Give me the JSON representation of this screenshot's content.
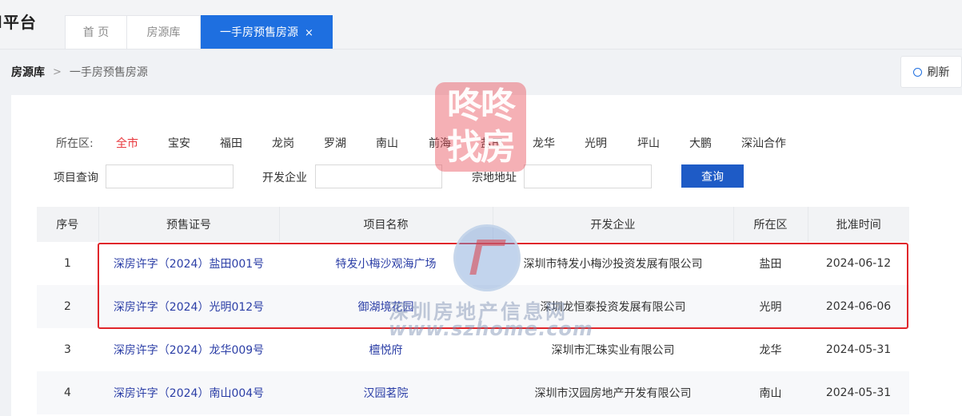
{
  "header": {
    "brand": "l平台",
    "tabs": [
      {
        "label": "首 页"
      },
      {
        "label": "房源库"
      },
      {
        "label": "一手房预售房源",
        "close": "×"
      }
    ]
  },
  "breadcrumb": {
    "root": "房源库",
    "sep": ">",
    "current": "一手房预售房源"
  },
  "refresh_label": "刷新",
  "filter": {
    "district_label": "所在区:",
    "districts": [
      "全市",
      "宝安",
      "福田",
      "龙岗",
      "罗湖",
      "南山",
      "前海",
      "盐田",
      "龙华",
      "光明",
      "坪山",
      "大鹏",
      "深汕合作"
    ],
    "active_district": "全市",
    "project_label": "项目查询",
    "developer_label": "开发企业",
    "address_label": "宗地地址",
    "project_value": "",
    "developer_value": "",
    "address_value": "",
    "search_button": "查询"
  },
  "table": {
    "headers": [
      "序号",
      "预售证号",
      "项目名称",
      "开发企业",
      "所在区",
      "批准时间"
    ],
    "rows": [
      {
        "no": "1",
        "cert": "深房许字（2024）盐田001号",
        "name": "特发小梅沙观海广场",
        "dev": "深圳市特发小梅沙投资发展有限公司",
        "dist": "盐田",
        "date": "2024-06-12"
      },
      {
        "no": "2",
        "cert": "深房许字（2024）光明012号",
        "name": "御湖境花园",
        "dev": "深圳龙恒泰投资发展有限公司",
        "dist": "光明",
        "date": "2024-06-06"
      },
      {
        "no": "3",
        "cert": "深房许字（2024）龙华009号",
        "name": "檀悦府",
        "dev": "深圳市汇珠实业有限公司",
        "dist": "龙华",
        "date": "2024-05-31"
      },
      {
        "no": "4",
        "cert": "深房许字（2024）南山004号",
        "name": "汉园茗院",
        "dev": "深圳市汉园房地产开发有限公司",
        "dist": "南山",
        "date": "2024-05-31"
      }
    ]
  },
  "watermark": {
    "logo_line1": "咚咚",
    "logo_line2": "找房",
    "text": "深圳房地产信息网",
    "url": "www.szhome.com"
  },
  "colors": {
    "accent": "#1e6fe0",
    "active_district": "#e8383d",
    "highlight": "#e0262b",
    "link": "#2b3ea6"
  }
}
